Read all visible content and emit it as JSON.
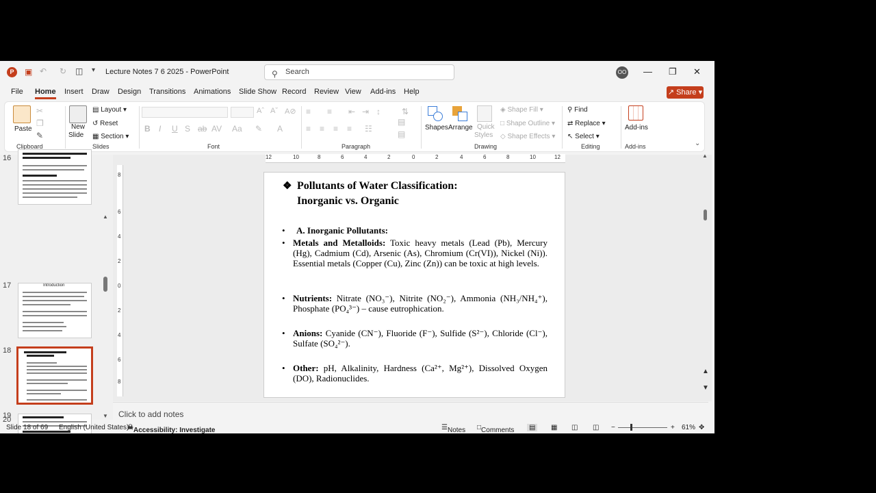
{
  "window": {
    "doc_title": "Lecture Notes 7 6 2025  -  PowerPoint",
    "search_placeholder": "Search",
    "avatar_initials": "OO"
  },
  "menu": {
    "file": "File",
    "home": "Home",
    "insert": "Insert",
    "draw": "Draw",
    "design": "Design",
    "transitions": "Transitions",
    "animations": "Animations",
    "slide_show": "Slide Show",
    "record": "Record",
    "review": "Review",
    "view": "View",
    "addins": "Add-ins",
    "help": "Help",
    "share": "Share"
  },
  "ribbon": {
    "paste": "Paste",
    "clipboard": "Clipboard",
    "new_slide_1": "New",
    "new_slide_2": "Slide",
    "layout": "Layout",
    "reset": "Reset",
    "section": "Section",
    "slides": "Slides",
    "font": "Font",
    "paragraph": "Paragraph",
    "shapes": "Shapes",
    "arrange": "Arrange",
    "quick_styles_1": "Quick",
    "quick_styles_2": "Styles",
    "shape_fill": "Shape Fill",
    "shape_outline": "Shape Outline",
    "shape_effects": "Shape Effects",
    "drawing": "Drawing",
    "find": "Find",
    "replace": "Replace",
    "select": "Select",
    "editing": "Editing",
    "addins": "Add-ins",
    "addins_group": "Add-ins"
  },
  "thumbnails": {
    "n16": "16",
    "n17": "17",
    "n18": "18",
    "n19": "19",
    "n20": "20",
    "t17_title": "Introduction"
  },
  "ruler": {
    "h": [
      "12",
      "10",
      "8",
      "6",
      "4",
      "2",
      "0",
      "2",
      "4",
      "6",
      "8",
      "10",
      "12"
    ],
    "v": [
      "8",
      "6",
      "4",
      "2",
      "0",
      "2",
      "4",
      "6",
      "8"
    ]
  },
  "slide": {
    "title_line1": "Pollutants of Water Classification:",
    "title_line2": "Inorganic vs. Organic",
    "sub_heading": "A. Inorganic Pollutants:",
    "item1_label": "Metals and Metalloids:",
    "item1_text": " Toxic heavy metals (Lead (Pb), Mercury (Hg), Cadmium (Cd), Arsenic (As), Chromium (Cr(VI)), Nickel (Ni)). Essential metals (Copper (Cu), Zinc (Zn)) can be toxic at high levels.",
    "item2_label": "Nutrients:",
    "item2_text": " Nitrate (NO₃⁻), Nitrite (NO₂⁻), Ammonia (NH₃/NH₄⁺), Phosphate (PO₄³⁻) – cause eutrophication.",
    "item3_label": "Anions:",
    "item3_text": " Cyanide (CN⁻), Fluoride (F⁻), Sulfide (S²⁻), Chloride (Cl⁻), Sulfate (SO₄²⁻).",
    "item4_label": "Other:",
    "item4_text": " pH, Alkalinity, Hardness (Ca²⁺, Mg²⁺), Dissolved Oxygen (DO), Radionuclides."
  },
  "notes_placeholder": "Click to add notes",
  "status": {
    "slide_of": "Slide 18 of 69",
    "language": "English (United States)",
    "accessibility": "Accessibility: Investigate",
    "notes": "Notes",
    "comments": "Comments",
    "zoom": "61%",
    "zoom_minus": "−",
    "zoom_plus": "+"
  },
  "colors": {
    "accent": "#c43e1c"
  }
}
